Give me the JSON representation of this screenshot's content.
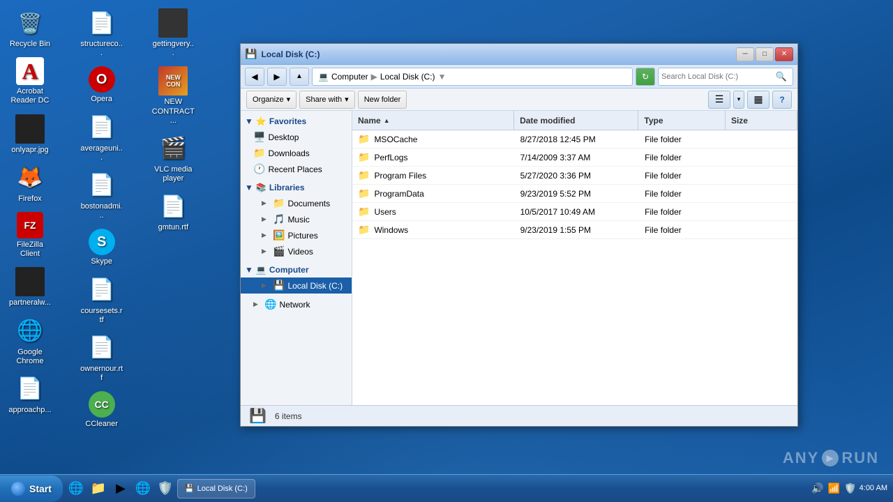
{
  "window": {
    "title": "Local Disk (C:)",
    "min_btn": "─",
    "max_btn": "□",
    "close_btn": "✕"
  },
  "address": {
    "path_computer": "Computer",
    "path_sep1": "▶",
    "path_localdisk": "Local Disk (C:)",
    "path_sep2": "▼",
    "search_placeholder": "Search Local Disk (C:)",
    "search_value": "Search Local Disk (C:)"
  },
  "toolbar": {
    "organize": "Organize",
    "share_with": "Share with",
    "new_folder": "New folder"
  },
  "sidebar": {
    "favorites_label": "Favorites",
    "desktop_label": "Desktop",
    "downloads_label": "Downloads",
    "recent_places_label": "Recent Places",
    "libraries_label": "Libraries",
    "documents_label": "Documents",
    "music_label": "Music",
    "pictures_label": "Pictures",
    "videos_label": "Videos",
    "computer_label": "Computer",
    "local_disk_label": "Local Disk (C:)",
    "network_label": "Network"
  },
  "columns": {
    "name": "Name",
    "date_modified": "Date modified",
    "type": "Type",
    "size": "Size"
  },
  "files": [
    {
      "name": "MSOCache",
      "date": "8/27/2018 12:45 PM",
      "type": "File folder",
      "size": ""
    },
    {
      "name": "PerfLogs",
      "date": "7/14/2009 3:37 AM",
      "type": "File folder",
      "size": ""
    },
    {
      "name": "Program Files",
      "date": "5/27/2020 3:36 PM",
      "type": "File folder",
      "size": ""
    },
    {
      "name": "ProgramData",
      "date": "9/23/2019 5:52 PM",
      "type": "File folder",
      "size": ""
    },
    {
      "name": "Users",
      "date": "10/5/2017 10:49 AM",
      "type": "File folder",
      "size": ""
    },
    {
      "name": "Windows",
      "date": "9/23/2019 1:55 PM",
      "type": "File folder",
      "size": ""
    }
  ],
  "status": {
    "count": "6 items"
  },
  "desktop_icons": [
    {
      "id": "recycle-bin",
      "label": "Recycle Bin",
      "icon": "🗑️"
    },
    {
      "id": "acrobat",
      "label": "Acrobat Reader DC",
      "icon": "📄"
    },
    {
      "id": "only-apr",
      "label": "onlyapr.jpg",
      "icon": "🖼️"
    },
    {
      "id": "firefox",
      "label": "Firefox",
      "icon": "🦊"
    },
    {
      "id": "filezilla",
      "label": "FileZilla Client",
      "icon": "📁"
    },
    {
      "id": "partner",
      "label": "partneralw...",
      "icon": "📄"
    },
    {
      "id": "chrome",
      "label": "Google Chrome",
      "icon": "🌐"
    },
    {
      "id": "approach",
      "label": "approachp...",
      "icon": "📄"
    },
    {
      "id": "structure",
      "label": "structureco...",
      "icon": "📄"
    },
    {
      "id": "opera",
      "label": "Opera",
      "icon": "O"
    },
    {
      "id": "average",
      "label": "averageuni...",
      "icon": "📄"
    },
    {
      "id": "bostonadmi",
      "label": "bostonadmi...",
      "icon": "📄"
    },
    {
      "id": "skype",
      "label": "Skype",
      "icon": "S"
    },
    {
      "id": "coursesets",
      "label": "coursesets.rtf",
      "icon": "📄"
    },
    {
      "id": "ownernour",
      "label": "ownernour.rtf",
      "icon": "📄"
    },
    {
      "id": "ccleaner",
      "label": "CCleaner",
      "icon": "🛡️"
    },
    {
      "id": "gettingvery",
      "label": "gettingvery...",
      "icon": "📄"
    },
    {
      "id": "new-contract",
      "label": "NEW CONTRACT...",
      "icon": "📄"
    },
    {
      "id": "vlc",
      "label": "VLC media player",
      "icon": "🎬"
    },
    {
      "id": "gmtun",
      "label": "gmtun.rtf",
      "icon": "📄"
    }
  ],
  "taskbar": {
    "start_label": "Start",
    "clock": "4:00 AM",
    "window_btn_label": "Local Disk (C:)"
  },
  "watermark": {
    "text_any": "ANY",
    "text_run": "RUN"
  }
}
